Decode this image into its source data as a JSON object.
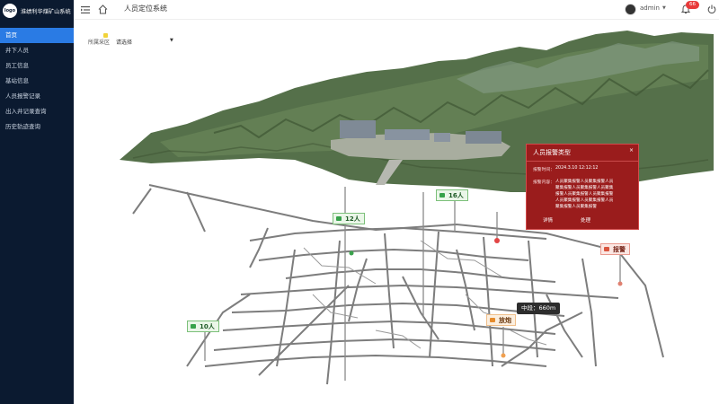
{
  "app": {
    "logo_text": "logo",
    "title": "淮绩利华煤矿山系统"
  },
  "sidebar": {
    "items": [
      {
        "label": "首页",
        "active": true
      },
      {
        "label": "井下人员",
        "active": false
      },
      {
        "label": "员工信息",
        "active": false
      },
      {
        "label": "基站信息",
        "active": false
      },
      {
        "label": "人员报警记录",
        "active": false
      },
      {
        "label": "出入井记录查询",
        "active": false
      },
      {
        "label": "历史轨迹查询",
        "active": false
      }
    ]
  },
  "header": {
    "title": "人员定位系统",
    "user": "admin",
    "notification_count": "66"
  },
  "filter": {
    "label": "所属采区",
    "value": "请选择"
  },
  "map": {
    "tags": [
      {
        "text": "12人",
        "style": "green"
      },
      {
        "text": "16人",
        "style": "green"
      },
      {
        "text": "10人",
        "style": "green"
      },
      {
        "text": "报警",
        "style": "red"
      },
      {
        "text": "放炮",
        "style": "orange"
      }
    ],
    "distance_label": "中段：660m"
  },
  "popup": {
    "title": "人员报警类型",
    "close": "×",
    "time_label": "报警时间：",
    "time_value": "2024.3.10 12:12:12",
    "content_label": "报警内容：",
    "content_lines": [
      "人员聚集报警人员聚集报警人员",
      "聚集报警人员聚集报警人员聚集",
      "报警人员聚集报警人员聚集报警",
      "人员聚集报警人员聚集报警人员",
      "聚集报警人员聚集报警"
    ],
    "detail_button": "详情",
    "handle_button": "处理"
  },
  "colors": {
    "sidebar_bg": "#0b1a30",
    "nav_active": "#2a7be4",
    "alarm_red": "#9a1c1c",
    "tunnel_gray": "#7d7d7d",
    "terrain_green": "#4d6a3a"
  }
}
